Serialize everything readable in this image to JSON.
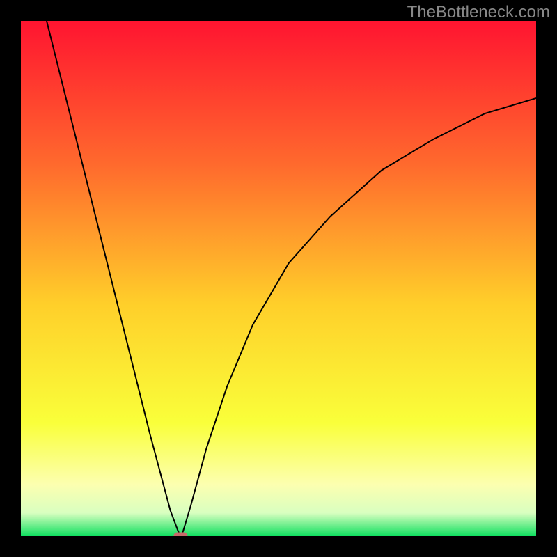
{
  "watermark": "TheBottleneck.com",
  "chart_data": {
    "type": "line",
    "title": "",
    "xlabel": "",
    "ylabel": "",
    "xlim": [
      0,
      100
    ],
    "ylim": [
      0,
      100
    ],
    "minimum_marker": {
      "x": 31,
      "y": 0,
      "shape": "rounded-rect",
      "color": "#c76a6a"
    },
    "series": [
      {
        "name": "left-branch",
        "x": [
          5,
          10,
          15,
          20,
          25,
          29,
          30.5,
          31
        ],
        "values": [
          100,
          80,
          60,
          40,
          20,
          5,
          1,
          0
        ]
      },
      {
        "name": "right-branch",
        "x": [
          31,
          31.5,
          33,
          36,
          40,
          45,
          52,
          60,
          70,
          80,
          90,
          100
        ],
        "values": [
          0,
          1,
          6,
          17,
          29,
          41,
          53,
          62,
          71,
          77,
          82,
          85
        ]
      }
    ],
    "background_gradient": {
      "stops": [
        {
          "offset": 0.0,
          "color": "#ff1430"
        },
        {
          "offset": 0.28,
          "color": "#ff6a2d"
        },
        {
          "offset": 0.55,
          "color": "#ffcf2a"
        },
        {
          "offset": 0.78,
          "color": "#f9ff3a"
        },
        {
          "offset": 0.9,
          "color": "#fcffb0"
        },
        {
          "offset": 0.955,
          "color": "#d9ffc0"
        },
        {
          "offset": 1.0,
          "color": "#10e060"
        }
      ]
    }
  }
}
